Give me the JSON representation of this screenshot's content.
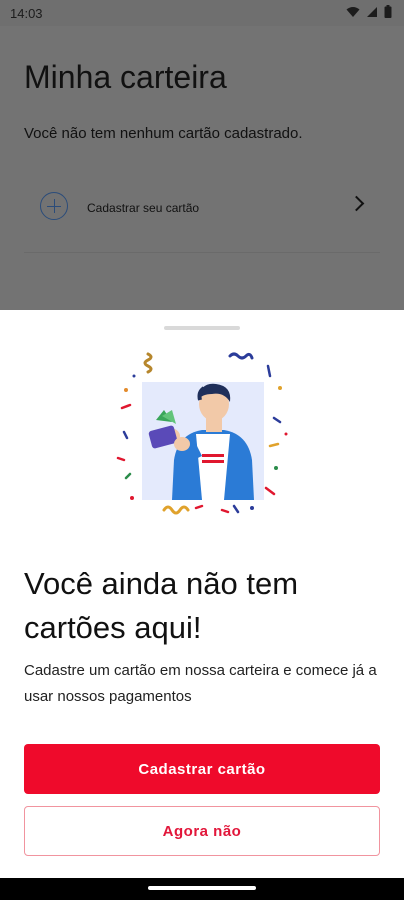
{
  "status_bar": {
    "time": "14:03",
    "icons": [
      "wifi-icon",
      "signal-icon",
      "battery-icon"
    ]
  },
  "background_screen": {
    "title": "Minha carteira",
    "subtitle": "Você não tem nenhum cartão cadastrado.",
    "add_card_row": {
      "label": "Cadastrar seu cartão",
      "icon": "plus-circle-icon",
      "chevron": "chevron-right-icon"
    }
  },
  "sheet": {
    "title": "Você ainda não tem cartões aqui!",
    "description": "Cadastre um cartão em nossa carteira e comece já a usar nossos pagamentos",
    "primary_button": "Cadastrar cartão",
    "secondary_button": "Agora não",
    "illustration": "person-holding-wallet-illustration"
  },
  "colors": {
    "primary": "#ef0a2b",
    "secondary_border": "#f1949f",
    "secondary_text": "#e2163a",
    "scrim": "#737373"
  }
}
